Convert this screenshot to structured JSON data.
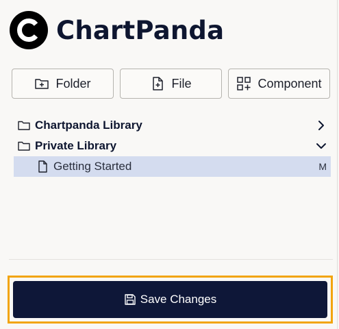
{
  "brand": {
    "name": "ChartPanda",
    "logo_icon": "chartpanda-c-logo-icon",
    "color": "#0e1630"
  },
  "actions": {
    "folder": {
      "label": "Folder",
      "icon": "folder-plus-icon"
    },
    "file": {
      "label": "File",
      "icon": "file-plus-icon"
    },
    "component": {
      "label": "Component",
      "icon": "component-plus-icon"
    }
  },
  "tree": {
    "items": [
      {
        "type": "folder",
        "label": "Chartpanda Library",
        "icon": "folder-icon",
        "chevron": "chevron-right-icon",
        "expanded": false
      },
      {
        "type": "folder",
        "label": "Private Library",
        "icon": "folder-icon",
        "chevron": "chevron-down-icon",
        "expanded": true
      },
      {
        "type": "file",
        "label": "Getting Started",
        "icon": "file-icon",
        "badge": "M",
        "selected": true
      }
    ],
    "selected_color": "#d4dcef"
  },
  "footer": {
    "save_label": "Save Changes",
    "save_icon": "save-icon",
    "button_color": "#0e1738",
    "focus_outline_color": "#f2a40c"
  }
}
